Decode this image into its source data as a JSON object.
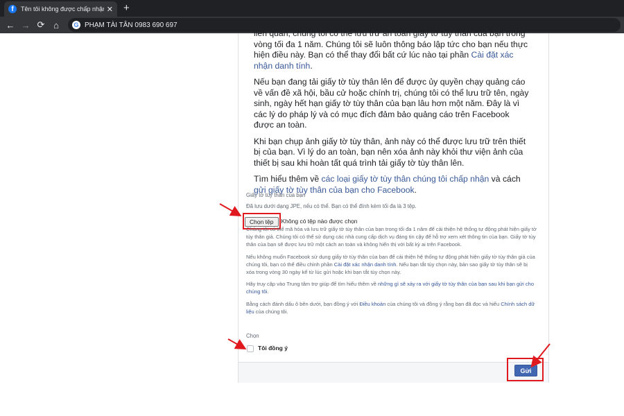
{
  "browser": {
    "tab_title": "Tên tôi không được chấp nhận | ",
    "tab_close": "✕",
    "new_tab": "+",
    "address": "PHẠM TÀI TÂN 0983 690 697",
    "tab_favicon": "f",
    "google_icon": "G",
    "icons": {
      "back": "←",
      "forward": "→",
      "reload": "⟳",
      "home": "⌂"
    }
  },
  "info_text": {
    "p1_text": "liên quan, chúng tôi có thể lưu trữ an toàn giấy tờ tùy thân của bạn trong vòng tối đa 1 năm. Chúng tôi sẽ luôn thông báo lập tức cho bạn nếu thực hiện điều này. Bạn có thể thay đổi bất cứ lúc nào tại phần ",
    "p1_link": "Cài đặt xác nhận danh tính",
    "p1_end": ".",
    "p2": "Nếu bạn đang tải giấy tờ tùy thân lên để được ủy quyền chạy quảng cáo về vấn đề xã hội, bầu cử hoặc chính trị, chúng tôi có thể lưu trữ tên, ngày sinh, ngày hết hạn giấy tờ tùy thân của bạn lâu hơn một năm. Đây là vì các lý do pháp lý và có mục đích đảm bảo quảng cáo trên Facebook được an toàn.",
    "p3": "Khi bạn chụp ảnh giấy tờ tùy thân, ảnh này có thể được lưu trữ trên thiết bị của bạn. Vì lý do an toàn, bạn nên xóa ảnh này khỏi thư viện ảnh của thiết bị sau khi hoàn tất quá trình tải giấy tờ tùy thân lên.",
    "p4_start": "Tìm hiểu thêm về ",
    "p4_link1": "các loại giấy tờ tùy thân chúng tôi chấp nhận",
    "p4_mid": " và cách ",
    "p4_link2": "gửi giấy tờ tùy thân của bạn cho Facebook",
    "p4_end": "."
  },
  "upload": {
    "label": "Giấy tờ tùy thân của bạn",
    "hint": "Đã lưu dưới dạng JPE, nếu có thể. Bạn có thể đính kèm tối đa là 3 tệp.",
    "choose_button": "Chọn tệp",
    "no_file": "Không có tệp nào được chọn"
  },
  "notes": {
    "n1": "Chúng tôi có thể mã hóa và lưu trữ giấy tờ tùy thân của bạn trong tối đa 1 năm để cải thiện hệ thống tự động phát hiện giấy tờ tùy thân giả. Chúng tôi có thể sử dụng các nhà cung cấp dịch vụ đáng tin cậy để hỗ trợ xem xét thông tin của bạn. Giấy tờ tùy thân của bạn sẽ được lưu trữ một cách an toàn và không hiển thị với bất kỳ ai trên Facebook.",
    "n2_start": "Nếu không muốn Facebook sử dụng giấy tờ tùy thân của bạn để cải thiện hệ thống tự động phát hiện giấy tờ tùy thân giả của chúng tôi, bạn có thể điều chỉnh phần ",
    "n2_link": "Cài đặt xác nhận danh tính",
    "n2_end": ". Nếu bạn tắt tùy chọn này, bản sao giấy tờ tùy thân sẽ bị xóa trong vòng 30 ngày kể từ lúc gửi hoặc khi bạn tắt tùy chọn này.",
    "n3_start": "Hãy truy cập vào Trung tâm trợ giúp để tìm hiểu thêm về ",
    "n3_link": "những gì sẽ xảy ra với giấy tờ tùy thân của bạn sau khi bạn gửi cho chúng tôi",
    "n3_end": ".",
    "n4_start": "Bằng cách đánh dấu ô bên dưới, bạn đồng ý với ",
    "n4_link1": "Điều khoản",
    "n4_mid": " của chúng tôi và đồng ý rằng bạn đã đọc và hiểu ",
    "n4_link2": "Chính sách dữ liệu",
    "n4_end": " của chúng tôi."
  },
  "choose": {
    "label": "Chọn",
    "agree": "Tôi đồng ý"
  },
  "submit_label": "Gửi",
  "annotation_color": "#e0191f"
}
